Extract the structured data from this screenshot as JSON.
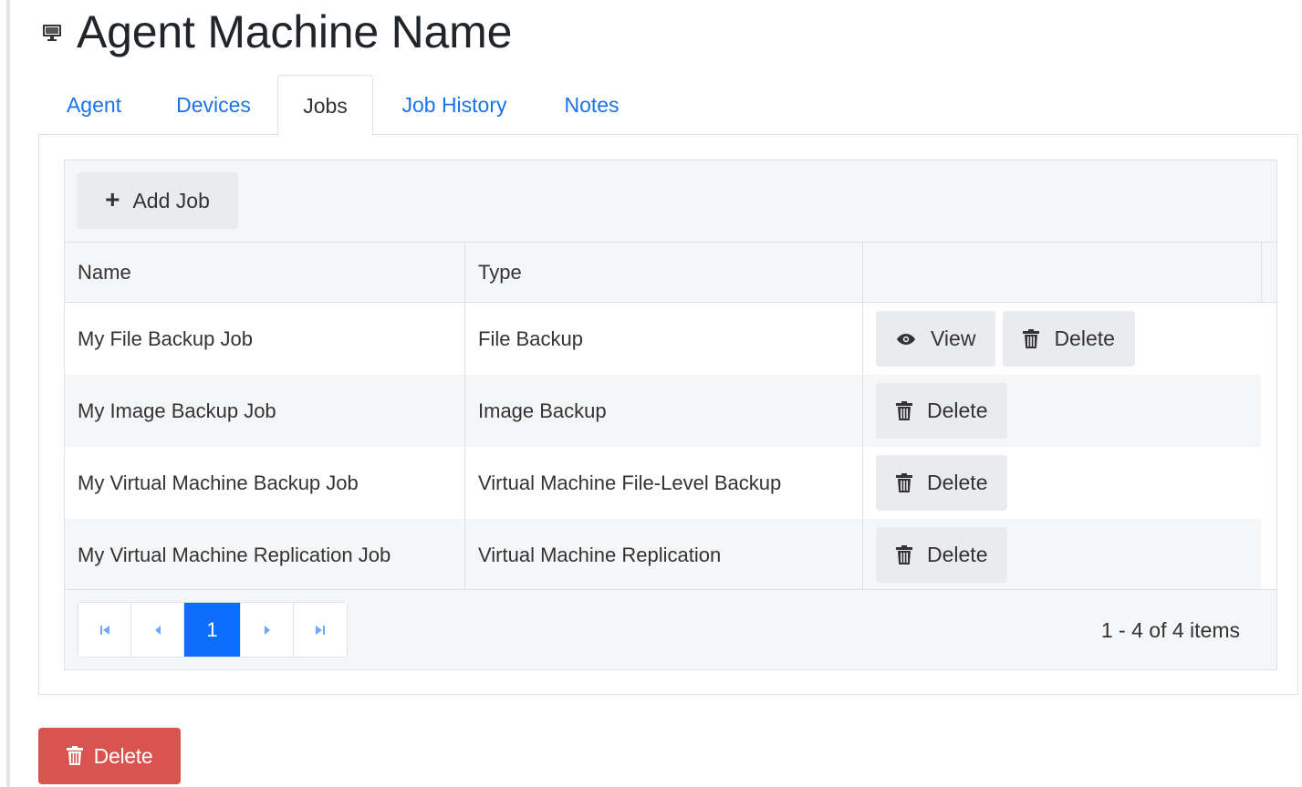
{
  "page": {
    "title": "Agent Machine Name"
  },
  "tabs": [
    {
      "label": "Agent",
      "active": false
    },
    {
      "label": "Devices",
      "active": false
    },
    {
      "label": "Jobs",
      "active": true
    },
    {
      "label": "Job History",
      "active": false
    },
    {
      "label": "Notes",
      "active": false
    }
  ],
  "toolbar": {
    "add_job_label": "Add Job"
  },
  "grid": {
    "columns": [
      "Name",
      "Type",
      ""
    ],
    "rows": [
      {
        "name": "My File Backup Job",
        "type": "File Backup",
        "actions": [
          "View",
          "Delete"
        ]
      },
      {
        "name": "My Image Backup Job",
        "type": "Image Backup",
        "actions": [
          "Delete"
        ]
      },
      {
        "name": "My Virtual Machine Backup Job",
        "type": "Virtual Machine File-Level Backup",
        "actions": [
          "Delete"
        ]
      },
      {
        "name": "My Virtual Machine Replication Job",
        "type": "Virtual Machine Replication",
        "actions": [
          "Delete"
        ]
      }
    ]
  },
  "pager": {
    "current_page": "1",
    "info": "1 - 4 of 4 items"
  },
  "footer": {
    "delete_label": "Delete"
  },
  "colors": {
    "link": "#1a73e8",
    "primary": "#0d6efd",
    "danger": "#d9534f",
    "toolbar_bg": "#f5f6f7"
  }
}
